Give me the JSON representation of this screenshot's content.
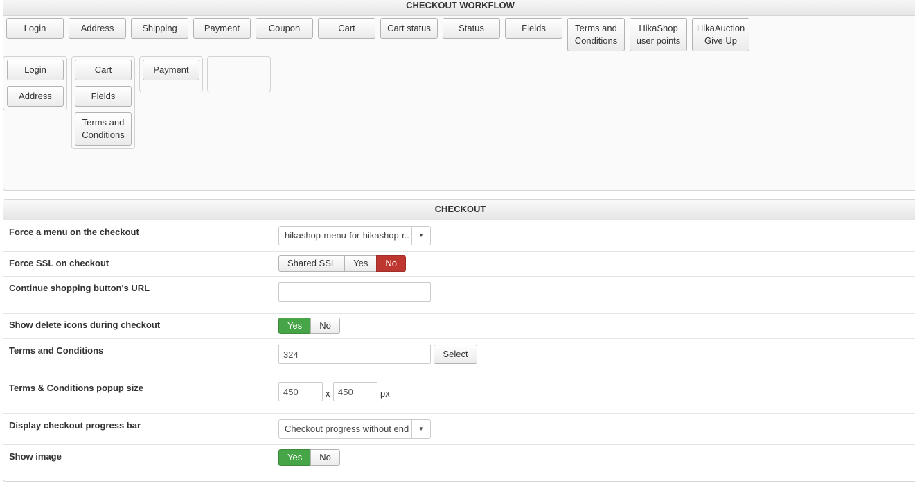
{
  "workflow": {
    "title": "CHECKOUT WORKFLOW",
    "available_steps": [
      "Login",
      "Address",
      "Shipping",
      "Payment",
      "Coupon",
      "Cart",
      "Cart status",
      "Status",
      "Fields",
      "Terms and Conditions",
      "HikaShop user points",
      "HikaAuction Give Up"
    ],
    "step_groups": [
      [
        "Login",
        "Address"
      ],
      [
        "Cart",
        "Fields",
        "Terms and Conditions"
      ],
      [
        "Payment"
      ],
      []
    ]
  },
  "checkout": {
    "title": "CHECKOUT",
    "force_menu": {
      "label": "Force a menu on the checkout",
      "value": "hikashop-menu-for-hikashop-r..."
    },
    "force_ssl": {
      "label": "Force SSL on checkout",
      "options": [
        "Shared SSL",
        "Yes",
        "No"
      ],
      "selected": "No"
    },
    "continue_url": {
      "label": "Continue shopping button's URL",
      "value": ""
    },
    "delete_icons": {
      "label": "Show delete icons during checkout",
      "options": [
        "Yes",
        "No"
      ],
      "selected": "Yes"
    },
    "terms": {
      "label": "Terms and Conditions",
      "value": "324",
      "select_label": "Select"
    },
    "popup_size": {
      "label": "Terms & Conditions popup size",
      "width": "450",
      "height": "450",
      "separator": "x",
      "unit": "px"
    },
    "progress_bar": {
      "label": "Display checkout progress bar",
      "value": "Checkout progress without end"
    },
    "show_image": {
      "label": "Show image",
      "options": [
        "Yes",
        "No"
      ],
      "selected": "Yes"
    }
  },
  "colors": {
    "active_green": "#46a546",
    "active_red": "#bd362f"
  }
}
